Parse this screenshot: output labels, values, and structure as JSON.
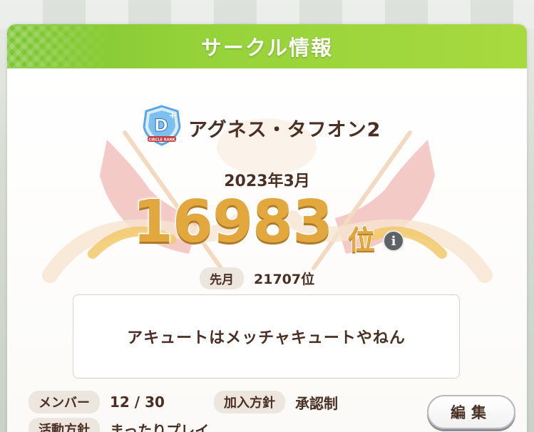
{
  "header": {
    "title": "サークル情報"
  },
  "circle": {
    "name": "アグネス・タフオン2",
    "rank_badge_label": "D+",
    "rank_badge_caption": "CIRCLE RANK"
  },
  "ranking": {
    "month": "2023年3月",
    "rank": "16983",
    "rank_unit": "位",
    "info_label": "i",
    "last_month_label": "先月",
    "last_month_value": "21707位"
  },
  "comment": "アキュートはメッチャキュートやねん",
  "details": {
    "members_label": "メンバー",
    "members_value": "12 / 30",
    "join_policy_label": "加入方針",
    "join_policy_value": "承認制",
    "activity_label": "活動方針",
    "activity_value": "まったりプレイ"
  },
  "buttons": {
    "edit": "編集"
  },
  "colors": {
    "header_green": "#95d23a",
    "rank_gold": "#e2a73d",
    "text_brown": "#4a2f22",
    "badge_blue": "#5aa6e6"
  }
}
